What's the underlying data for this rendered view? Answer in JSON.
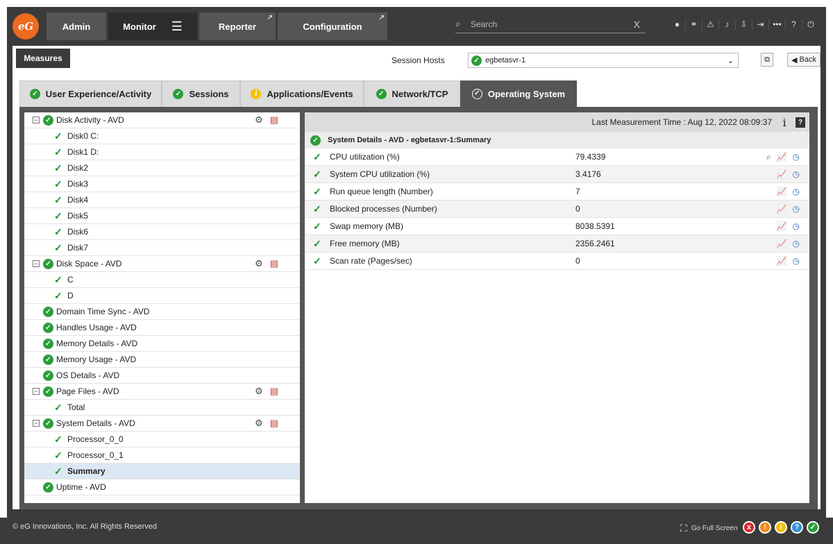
{
  "topbar": {
    "logo": "eG",
    "nav": [
      {
        "label": "Admin"
      },
      {
        "label": "Monitor"
      },
      {
        "label": "Reporter"
      },
      {
        "label": "Configuration"
      }
    ],
    "search_placeholder": "Search",
    "search_clear": "X"
  },
  "toolbar": {
    "measures_label": "Measures",
    "session_hosts_label": "Session Hosts",
    "session_host_value": "egbetasvr-1",
    "back_label": "Back"
  },
  "tabs": [
    {
      "label": "User Experience/Activity",
      "status": "ok"
    },
    {
      "label": "Sessions",
      "status": "ok"
    },
    {
      "label": "Applications/Events",
      "status": "info"
    },
    {
      "label": "Network/TCP",
      "status": "ok"
    },
    {
      "label": "Operating System",
      "status": "ok"
    }
  ],
  "tree": [
    {
      "label": "Disk Activity - AVD",
      "level": 0,
      "expandable": true,
      "tools": true
    },
    {
      "label": "Disk0 C:",
      "level": 1
    },
    {
      "label": "Disk1 D:",
      "level": 1
    },
    {
      "label": "Disk2",
      "level": 1
    },
    {
      "label": "Disk3",
      "level": 1
    },
    {
      "label": "Disk4",
      "level": 1
    },
    {
      "label": "Disk5",
      "level": 1
    },
    {
      "label": "Disk6",
      "level": 1
    },
    {
      "label": "Disk7",
      "level": 1
    },
    {
      "label": "Disk Space - AVD",
      "level": 0,
      "expandable": true,
      "tools": true
    },
    {
      "label": "C",
      "level": 1
    },
    {
      "label": "D",
      "level": 1
    },
    {
      "label": "Domain Time Sync - AVD",
      "level": 0
    },
    {
      "label": "Handles Usage - AVD",
      "level": 0
    },
    {
      "label": "Memory Details - AVD",
      "level": 0
    },
    {
      "label": "Memory Usage - AVD",
      "level": 0
    },
    {
      "label": "OS Details - AVD",
      "level": 0
    },
    {
      "label": "Page Files - AVD",
      "level": 0,
      "expandable": true,
      "tools": true
    },
    {
      "label": "Total",
      "level": 1
    },
    {
      "label": "System Details - AVD",
      "level": 0,
      "expandable": true,
      "tools": true
    },
    {
      "label": "Processor_0_0",
      "level": 1
    },
    {
      "label": "Processor_0_1",
      "level": 1
    },
    {
      "label": "Summary",
      "level": 1,
      "selected": true
    },
    {
      "label": "Uptime - AVD",
      "level": 0
    }
  ],
  "detail": {
    "last_measurement": "Last Measurement Time : Aug 12, 2022 08:09:37",
    "title": "System Details - AVD - egbetasvr-1:Summary",
    "measures": [
      {
        "name": "CPU utilization (%)",
        "value": "79.4339",
        "search": true
      },
      {
        "name": "System CPU utilization (%)",
        "value": "3.4176"
      },
      {
        "name": "Run queue length (Number)",
        "value": "7"
      },
      {
        "name": "Blocked processes (Number)",
        "value": "0"
      },
      {
        "name": "Swap memory (MB)",
        "value": "8038.5391"
      },
      {
        "name": "Free memory (MB)",
        "value": "2356.2461"
      },
      {
        "name": "Scan rate (Pages/sec)",
        "value": "0"
      }
    ]
  },
  "footer": {
    "copyright": "© eG Innovations, Inc. All Rights Reserved",
    "fullscreen": "Go Full Screen",
    "status_colors": [
      "#d9262c",
      "#f28c1a",
      "#f2c200",
      "#2f8fd8",
      "#2e9d3a"
    ]
  }
}
